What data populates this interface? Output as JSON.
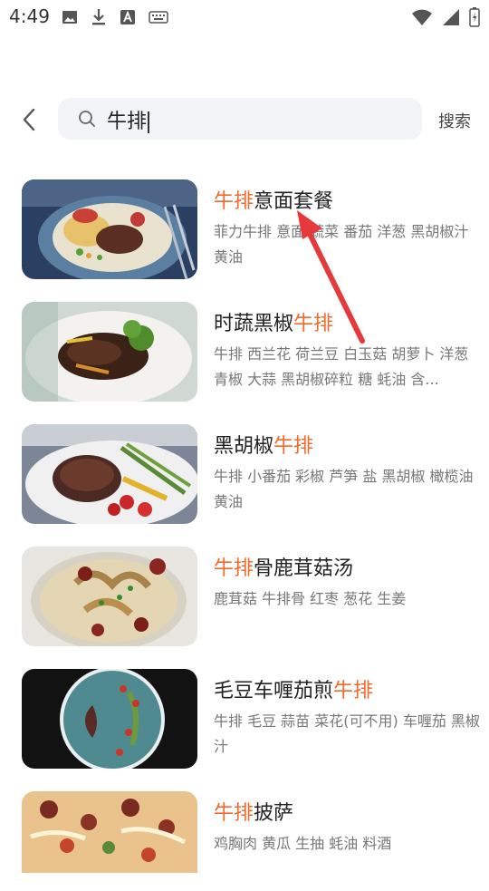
{
  "status": {
    "time": "4:49"
  },
  "search": {
    "query": "牛排",
    "button_label": "搜索"
  },
  "results": [
    {
      "title_parts": [
        {
          "text": "牛排",
          "hl": true
        },
        {
          "text": "意面套餐",
          "hl": false
        }
      ],
      "desc": "菲力牛排 意面 蔬菜 番茄 洋葱 黑胡椒汁 黄油"
    },
    {
      "title_parts": [
        {
          "text": "时蔬黑椒",
          "hl": false
        },
        {
          "text": "牛排",
          "hl": true
        }
      ],
      "desc": "牛排 西兰花 荷兰豆 白玉菇 胡萝卜 洋葱 青椒 大蒜 黑胡椒碎粒 糖 蚝油 含..."
    },
    {
      "title_parts": [
        {
          "text": "黑胡椒",
          "hl": false
        },
        {
          "text": "牛排",
          "hl": true
        }
      ],
      "desc": "牛排 小番茄 彩椒 芦笋 盐 黑胡椒 橄榄油 黄油"
    },
    {
      "title_parts": [
        {
          "text": "牛排",
          "hl": true
        },
        {
          "text": "骨鹿茸菇汤",
          "hl": false
        }
      ],
      "desc": "鹿茸菇 牛排骨 红枣 葱花 生姜"
    },
    {
      "title_parts": [
        {
          "text": "毛豆车喱茄煎",
          "hl": false
        },
        {
          "text": "牛排",
          "hl": true
        }
      ],
      "desc": "牛排 毛豆 蒜苗 菜花(可不用) 车喱茄 黑椒汁"
    },
    {
      "title_parts": [
        {
          "text": "牛排",
          "hl": true
        },
        {
          "text": "披萨",
          "hl": false
        }
      ],
      "desc": "鸡胸肉 黄瓜 生抽 蚝油 料酒"
    }
  ],
  "colors": {
    "highlight": "#f26b2c",
    "annotation_arrow": "#e5393b"
  }
}
